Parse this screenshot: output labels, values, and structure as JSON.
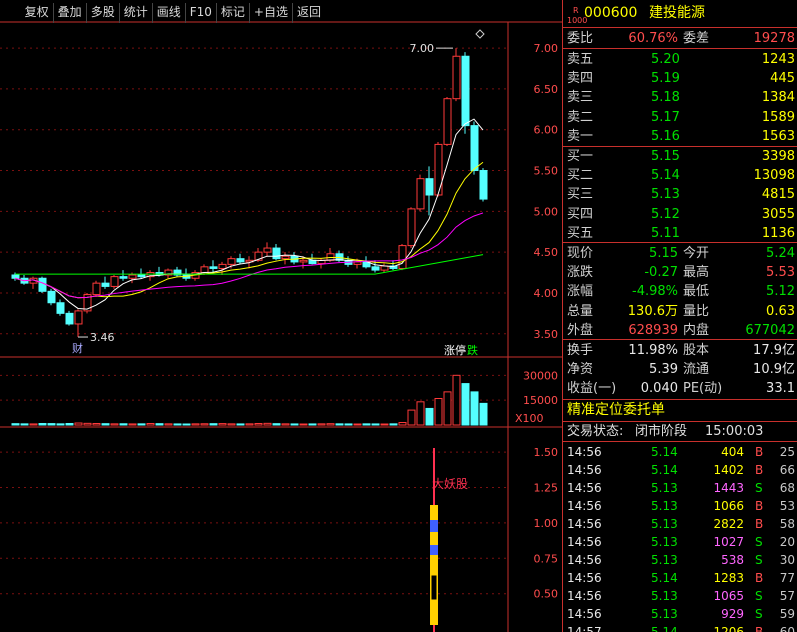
{
  "toolbar": [
    "复权",
    "叠加",
    "多股",
    "统计",
    "画线",
    "F10",
    "标记",
    "+自选",
    "返回"
  ],
  "stock": {
    "badge_r": "R",
    "badge_num": "1000",
    "code": "000600",
    "name": "建投能源"
  },
  "weibi": {
    "label1": "委比",
    "value1": "60.76%",
    "label2": "委差",
    "value2": "19278"
  },
  "sell": [
    {
      "label": "卖五",
      "price": "5.20",
      "vol": "1243"
    },
    {
      "label": "卖四",
      "price": "5.19",
      "vol": "445"
    },
    {
      "label": "卖三",
      "price": "5.18",
      "vol": "1384"
    },
    {
      "label": "卖二",
      "price": "5.17",
      "vol": "1589"
    },
    {
      "label": "卖一",
      "price": "5.16",
      "vol": "1563"
    }
  ],
  "buy": [
    {
      "label": "买一",
      "price": "5.15",
      "vol": "3398"
    },
    {
      "label": "买二",
      "price": "5.14",
      "vol": "13098"
    },
    {
      "label": "买三",
      "price": "5.13",
      "vol": "4815"
    },
    {
      "label": "买四",
      "price": "5.12",
      "vol": "3055"
    },
    {
      "label": "买五",
      "price": "5.11",
      "vol": "1136"
    }
  ],
  "quote": [
    {
      "l1": "现价",
      "v1": "5.15",
      "l2": "今开",
      "v2": "5.24"
    },
    {
      "l1": "涨跌",
      "v1": "-0.27",
      "l2": "最高",
      "v2": "5.53"
    },
    {
      "l1": "涨幅",
      "v1": "-4.98%",
      "l2": "最低",
      "v2": "5.12"
    },
    {
      "l1": "总量",
      "v1": "130.6万",
      "l2": "量比",
      "v2": "0.63"
    },
    {
      "l1": "外盘",
      "v1": "628939",
      "l2": "内盘",
      "v2": "677042"
    }
  ],
  "fund": [
    {
      "l1": "换手",
      "v1": "11.98%",
      "l2": "股本",
      "v2": "17.9亿"
    },
    {
      "l1": "净资",
      "v1": "5.39",
      "l2": "流通",
      "v2": "10.9亿"
    },
    {
      "l1": "收益(一)",
      "v1": "0.040",
      "l2": "PE(动)",
      "v2": "33.1"
    }
  ],
  "orders_title": "精准定位委托单",
  "trade_status": {
    "label": "交易状态:",
    "value": "闭市阶段",
    "time": "15:00:03"
  },
  "trades": [
    {
      "time": "14:56",
      "price": "5.14",
      "vol": "404",
      "side": "B",
      "n": "25"
    },
    {
      "time": "14:56",
      "price": "5.14",
      "vol": "1402",
      "side": "B",
      "n": "66"
    },
    {
      "time": "14:56",
      "price": "5.13",
      "vol": "1443",
      "side": "S",
      "n": "68"
    },
    {
      "time": "14:56",
      "price": "5.13",
      "vol": "1066",
      "side": "B",
      "n": "53"
    },
    {
      "time": "14:56",
      "price": "5.13",
      "vol": "2822",
      "side": "B",
      "n": "58"
    },
    {
      "time": "14:56",
      "price": "5.13",
      "vol": "1027",
      "side": "S",
      "n": "20"
    },
    {
      "time": "14:56",
      "price": "5.13",
      "vol": "538",
      "side": "S",
      "n": "30"
    },
    {
      "time": "14:56",
      "price": "5.14",
      "vol": "1283",
      "side": "B",
      "n": "77"
    },
    {
      "time": "14:56",
      "price": "5.13",
      "vol": "1065",
      "side": "S",
      "n": "57"
    },
    {
      "time": "14:56",
      "price": "5.13",
      "vol": "929",
      "side": "S",
      "n": "59"
    },
    {
      "time": "14:57",
      "price": "5.14",
      "vol": "1206",
      "side": "B",
      "n": "60"
    }
  ],
  "chart_data": {
    "type": "candlestick",
    "price_axis": [
      "7.00",
      "6.50",
      "6.00",
      "5.50",
      "5.00",
      "4.50",
      "4.00",
      "3.50"
    ],
    "price_range": [
      3.35,
      7.05
    ],
    "high_label": "7.00",
    "low_label": "3.46",
    "finance_marker": "财",
    "markers": [
      "涨停",
      "跌"
    ],
    "volume_axis": [
      "30000",
      "15000"
    ],
    "volume_unit": "X100",
    "indicator_axis": [
      "1.50",
      "1.25",
      "1.00",
      "0.75",
      "0.50"
    ],
    "indicator_range": [
      0.3,
      1.6
    ],
    "indicator_label": "大妖股",
    "candles": [
      [
        4.22,
        4.25,
        4.15,
        4.18
      ],
      [
        4.18,
        4.22,
        4.1,
        4.12
      ],
      [
        4.12,
        4.2,
        4.05,
        4.18
      ],
      [
        4.18,
        4.2,
        4.0,
        4.02
      ],
      [
        4.02,
        4.05,
        3.85,
        3.88
      ],
      [
        3.88,
        3.92,
        3.72,
        3.75
      ],
      [
        3.75,
        3.78,
        3.6,
        3.62
      ],
      [
        3.62,
        3.8,
        3.46,
        3.78
      ],
      [
        3.78,
        4.0,
        3.75,
        3.98
      ],
      [
        3.98,
        4.15,
        3.95,
        4.12
      ],
      [
        4.12,
        4.2,
        4.05,
        4.08
      ],
      [
        4.08,
        4.22,
        4.05,
        4.2
      ],
      [
        4.2,
        4.28,
        4.15,
        4.18
      ],
      [
        4.18,
        4.25,
        4.12,
        4.22
      ],
      [
        4.22,
        4.3,
        4.18,
        4.2
      ],
      [
        4.2,
        4.28,
        4.15,
        4.25
      ],
      [
        4.25,
        4.32,
        4.2,
        4.22
      ],
      [
        4.22,
        4.3,
        4.18,
        4.28
      ],
      [
        4.28,
        4.32,
        4.2,
        4.22
      ],
      [
        4.22,
        4.3,
        4.15,
        4.18
      ],
      [
        4.18,
        4.28,
        4.15,
        4.25
      ],
      [
        4.25,
        4.35,
        4.22,
        4.32
      ],
      [
        4.32,
        4.4,
        4.25,
        4.3
      ],
      [
        4.3,
        4.38,
        4.22,
        4.35
      ],
      [
        4.35,
        4.45,
        4.3,
        4.42
      ],
      [
        4.42,
        4.48,
        4.35,
        4.38
      ],
      [
        4.38,
        4.45,
        4.3,
        4.4
      ],
      [
        4.4,
        4.55,
        4.38,
        4.5
      ],
      [
        4.5,
        4.62,
        4.45,
        4.55
      ],
      [
        4.55,
        4.6,
        4.4,
        4.42
      ],
      [
        4.42,
        4.5,
        4.35,
        4.45
      ],
      [
        4.45,
        4.5,
        4.35,
        4.38
      ],
      [
        4.38,
        4.45,
        4.3,
        4.4
      ],
      [
        4.4,
        4.48,
        4.35,
        4.36
      ],
      [
        4.36,
        4.42,
        4.3,
        4.4
      ],
      [
        4.4,
        4.55,
        4.38,
        4.48
      ],
      [
        4.48,
        4.52,
        4.38,
        4.4
      ],
      [
        4.4,
        4.45,
        4.32,
        4.35
      ],
      [
        4.35,
        4.42,
        4.3,
        4.38
      ],
      [
        4.38,
        4.45,
        4.3,
        4.32
      ],
      [
        4.32,
        4.4,
        4.25,
        4.28
      ],
      [
        4.28,
        4.36,
        4.25,
        4.33
      ],
      [
        4.33,
        4.4,
        4.28,
        4.3
      ],
      [
        4.3,
        4.6,
        4.28,
        4.58
      ],
      [
        4.58,
        5.05,
        4.55,
        5.03
      ],
      [
        5.03,
        5.45,
        5.0,
        5.4
      ],
      [
        5.4,
        5.55,
        4.95,
        5.2
      ],
      [
        5.2,
        5.85,
        5.18,
        5.82
      ],
      [
        5.82,
        6.4,
        5.8,
        6.38
      ],
      [
        6.38,
        7.0,
        6.35,
        6.9
      ],
      [
        6.9,
        6.95,
        5.95,
        6.05
      ],
      [
        6.05,
        6.1,
        5.45,
        5.5
      ],
      [
        5.5,
        5.53,
        5.12,
        5.15
      ]
    ],
    "volumes": [
      800,
      700,
      650,
      900,
      850,
      700,
      900,
      1200,
      1000,
      900,
      800,
      700,
      750,
      650,
      700,
      900,
      800,
      700,
      650,
      600,
      700,
      750,
      800,
      850,
      700,
      650,
      700,
      900,
      1000,
      800,
      700,
      650,
      600,
      650,
      700,
      800,
      700,
      650,
      600,
      700,
      650,
      600,
      700,
      1500,
      9000,
      14000,
      10000,
      16000,
      20000,
      30000,
      25000,
      20000,
      13060
    ],
    "ma_series": [
      {
        "name": "MA5",
        "color": "#ffffff"
      },
      {
        "name": "MA10",
        "color": "#ffff00"
      },
      {
        "name": "MA20",
        "color": "#ff00ff"
      },
      {
        "name": "MA60",
        "color": "#00ff00"
      }
    ]
  }
}
